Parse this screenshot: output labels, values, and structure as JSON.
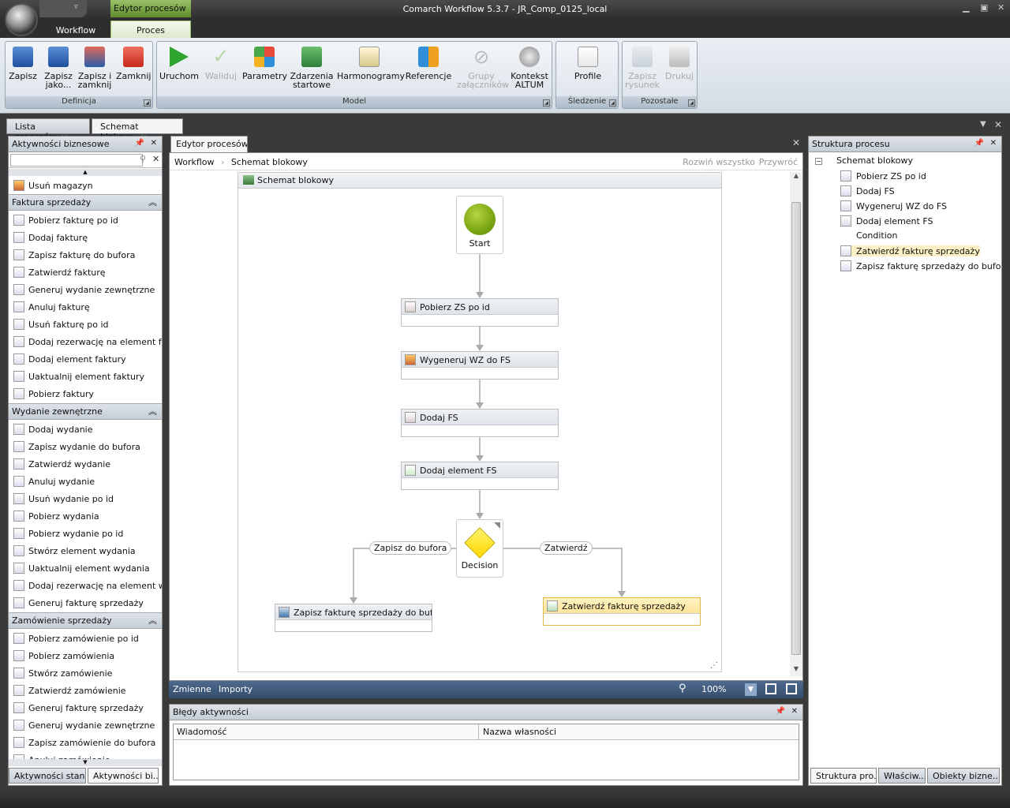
{
  "window": {
    "title": "Comarch Workflow 5.3.7 - JR_Comp_0125_local",
    "context_tab": "Edytor procesów",
    "min": "▁",
    "max": "▣",
    "close": "✕"
  },
  "ribbon_tabs": [
    "Workflow",
    "Proces"
  ],
  "ribbon": {
    "groups": [
      {
        "label": "Definicja"
      },
      {
        "label": "Model"
      },
      {
        "label": "Śledzenie"
      },
      {
        "label": "Pozostałe"
      }
    ],
    "buttons": {
      "zapisz": "Zapisz",
      "zapisz_jako": "Zapisz jako...",
      "zapisz_zamknij": "Zapisz i zamknij",
      "zamknij": "Zamknij",
      "uruchom": "Uruchom",
      "waliduj": "Waliduj",
      "parametry": "Parametry",
      "zdarzenia": "Zdarzenia startowe",
      "harmonogramy": "Harmonogramy",
      "referencje": "Referencje",
      "grupy": "Grupy załączników",
      "kontekst": "Kontekst ALTUM",
      "profile": "Profile",
      "zapisz_rysunek": "Zapisz rysunek",
      "drukuj": "Drukuj"
    }
  },
  "doc_tabs": [
    {
      "label": "Lista procesów"
    },
    {
      "label": "Schemat blokowy"
    }
  ],
  "left_panel": {
    "title": "Aktywności biznesowe",
    "search_placeholder": "",
    "first_item": "Usuń magazyn",
    "categories": [
      {
        "label": "Faktura sprzedaży",
        "items": [
          "Pobierz fakturę po id",
          "Dodaj fakturę",
          "Zapisz fakturę do bufora",
          "Zatwierdź fakturę",
          "Generuj wydanie zewnętrzne",
          "Anuluj fakturę",
          "Usuń fakturę po id",
          "Dodaj rezerwację na element faktury",
          "Dodaj element faktury",
          "Uaktualnij element faktury",
          "Pobierz faktury"
        ]
      },
      {
        "label": "Wydanie zewnętrzne",
        "items": [
          "Dodaj wydanie",
          "Zapisz wydanie do bufora",
          "Zatwierdź wydanie",
          "Anuluj wydanie",
          "Usuń wydanie po id",
          "Pobierz wydania",
          "Pobierz wydanie po id",
          "Stwórz element wydania",
          "Uaktualnij element wydania",
          "Dodaj rezerwację na element wydania",
          "Generuj fakturę sprzedaży"
        ]
      },
      {
        "label": "Zamówienie sprzedaży",
        "items": [
          "Pobierz zamówienie po id",
          "Pobierz zamówienia",
          "Stwórz zamówienie",
          "Zatwierdź zamówienie",
          "Generuj fakturę sprzedaży",
          "Generuj wydanie zewnętrzne",
          "Zapisz zamówienie do bufora",
          "Anuluj zamówienie"
        ]
      }
    ],
    "bottom_tabs": [
      "Aktywności stan...",
      "Aktywności bi..."
    ]
  },
  "editor": {
    "tab": "Edytor procesów",
    "breadcrumb": [
      "Workflow",
      "Schemat blokowy"
    ],
    "expand_all": "Rozwiń wszystko",
    "restore": "Przywróć",
    "canvas_title": "Schemat blokowy",
    "start_label": "Start",
    "nodes": [
      "Pobierz ZS po id",
      "Wygeneruj WZ do FS",
      "Dodaj FS",
      "Dodaj element FS"
    ],
    "decision_label": "Decision",
    "branch_left": "Zapisz do bufora",
    "branch_right": "Zatwierdź",
    "left_node": "Zapisz fakturę sprzedaży do bufora",
    "right_node": "Zatwierdź fakturę sprzedaży",
    "bottom_bar": {
      "vars": "Zmienne",
      "imports": "Importy",
      "zoom": "100%"
    }
  },
  "errors_panel": {
    "title": "Błędy aktywności",
    "col1": "Wiadomość",
    "col2": "Nazwa własności"
  },
  "right_panel": {
    "title": "Struktura procesu",
    "root": "Schemat blokowy",
    "items": [
      "Pobierz ZS po id",
      "Dodaj FS",
      "Wygeneruj WZ do FS",
      "Dodaj element FS",
      "Condition",
      "Zatwierdź fakturę sprzedaży",
      "Zapisz fakturę sprzedaży do bufora"
    ],
    "bottom_tabs": [
      "Struktura pro...",
      "Właściw...",
      "Obiekty bizne..."
    ]
  },
  "colors": {
    "accent": "#9bc26a",
    "start": "#7aa512",
    "decision": "#ffe000",
    "selected": "#fde49a"
  }
}
